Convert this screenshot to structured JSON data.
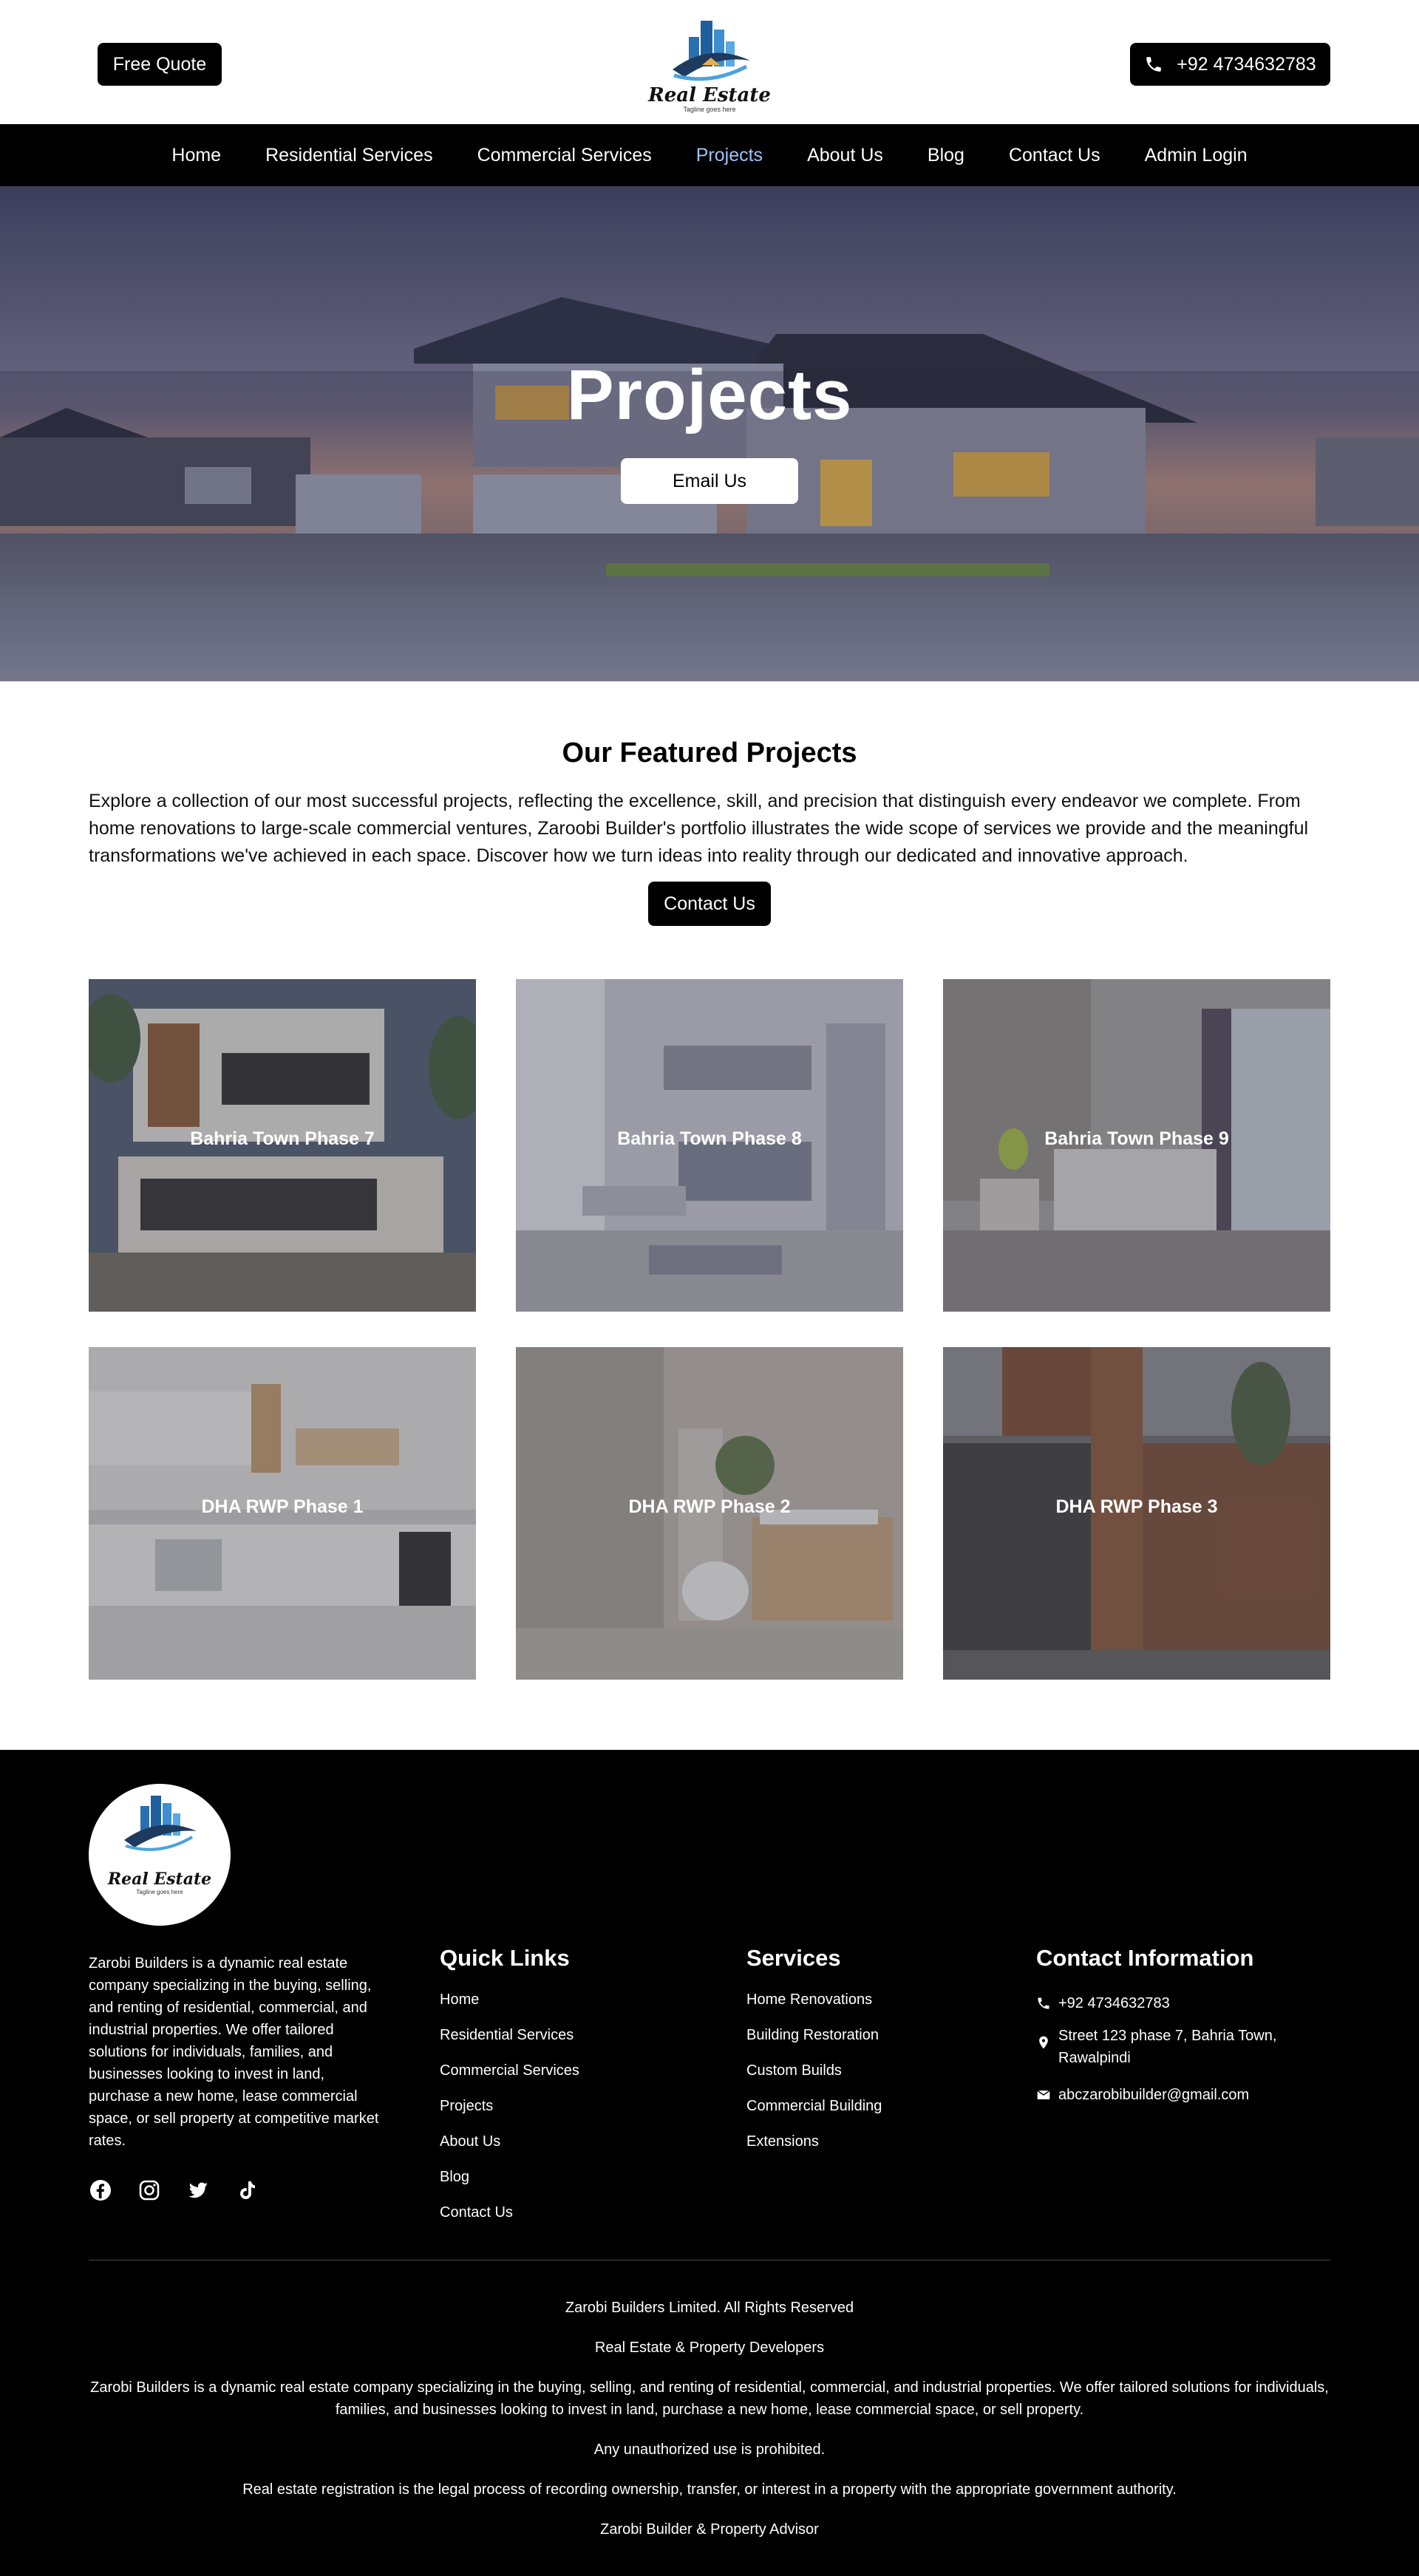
{
  "header": {
    "free_quote": "Free Quote",
    "phone": "+92 4734632783",
    "logo_text": "Real Estate",
    "logo_tagline": "Tagline goes here"
  },
  "nav": {
    "items": [
      "Home",
      "Residential Services",
      "Commercial Services",
      "Projects",
      "About Us",
      "Blog",
      "Contact Us",
      "Admin Login"
    ],
    "active": "Projects",
    "active_color": "#9dc3f7"
  },
  "hero": {
    "title": "Projects",
    "button": "Email Us"
  },
  "featured": {
    "title": "Our Featured Projects",
    "description": "Explore a collection of our most successful projects, reflecting the excellence, skill, and precision that distinguish every endeavor we complete. From home renovations to large-scale commercial ventures, Zaroobi Builder's portfolio illustrates the wide scope of services we provide and the meaningful transformations we've achieved in each space. Discover how we turn ideas into reality through our dedicated and innovative approach.",
    "button": "Contact Us"
  },
  "projects": [
    {
      "name": "Bahria Town Phase 7"
    },
    {
      "name": "Bahria Town Phase 8"
    },
    {
      "name": "Bahria Town Phase 9"
    },
    {
      "name": "DHA RWP Phase 1"
    },
    {
      "name": "DHA RWP Phase 2"
    },
    {
      "name": "DHA RWP Phase 3"
    }
  ],
  "footer": {
    "about": "Zarobi Builders is a dynamic real estate company specializing in the buying, selling, and renting of residential, commercial, and industrial properties. We offer tailored solutions for individuals, families, and businesses looking to invest in land, purchase a new home, lease commercial space, or sell property at competitive market rates.",
    "socials": [
      "facebook-icon",
      "instagram-icon",
      "twitter-icon",
      "tiktok-icon"
    ],
    "quick_links_title": "Quick Links",
    "quick_links": [
      "Home",
      "Residential Services",
      "Commercial Services",
      "Projects",
      "About Us",
      "Blog",
      "Contact Us"
    ],
    "services_title": "Services",
    "services": [
      "Home Renovations",
      "Building Restoration",
      "Custom Builds",
      "Commercial Building",
      "Extensions"
    ],
    "contact_title": "Contact Information",
    "contact_phone": "+92 4734632783",
    "contact_address": "Street 123 phase 7, Bahria Town, Rawalpindi",
    "contact_email": "abczarobibuilder@gmail.com",
    "bottom": {
      "rights": "Zarobi Builders Limited. All Rights Reserved",
      "tag": "Real Estate & Property Developers",
      "about": "Zarobi Builders is a dynamic real estate company specializing in the buying, selling, and renting of residential, commercial, and industrial properties. We offer tailored solutions for individuals, families, and businesses looking to invest in land, purchase a new home, lease commercial space, or sell property.",
      "unauthorized": "Any unauthorized use is prohibited.",
      "registration": "Real estate registration is the legal process of recording ownership, transfer, or interest in a property with the appropriate government authority.",
      "advisor": "Zarobi Builder & Property Advisor"
    }
  }
}
